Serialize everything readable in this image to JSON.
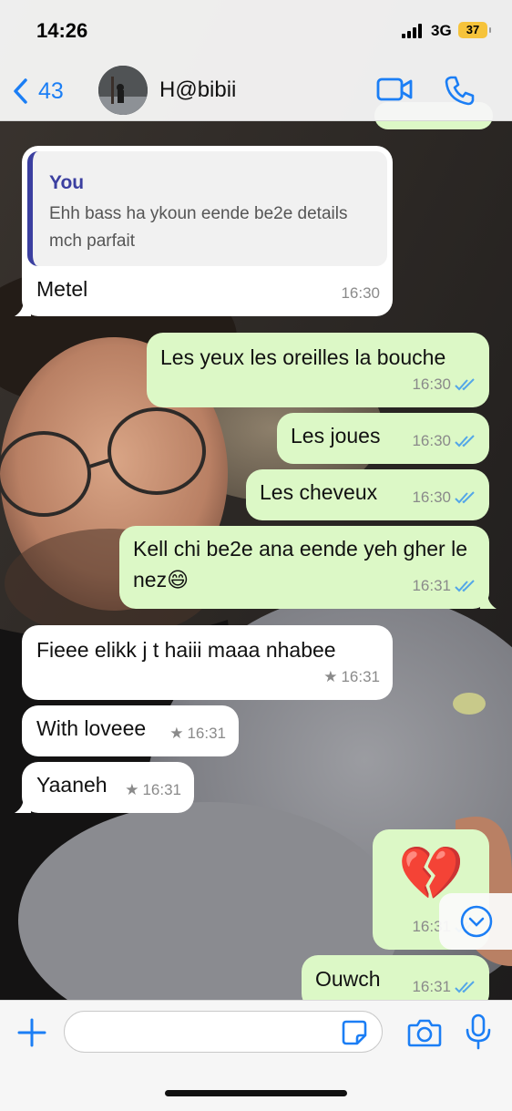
{
  "status": {
    "time": "14:26",
    "network": "3G",
    "battery": "37"
  },
  "header": {
    "back_count": "43",
    "contact_name": "H@bibii",
    "icons": [
      "video-call-icon",
      "phone-icon"
    ]
  },
  "messages": [
    {
      "dir": "in",
      "quote_author": "You",
      "quote_text": "Ehh bass ha ykoun eende be2e details mch parfait",
      "text": "Metel",
      "time": "16:30"
    },
    {
      "dir": "out",
      "text": "Les yeux les oreilles la bouche",
      "time": "16:30",
      "status": "read"
    },
    {
      "dir": "out",
      "text": "Les joues",
      "time": "16:30",
      "status": "read"
    },
    {
      "dir": "out",
      "text": "Les cheveux",
      "time": "16:30",
      "status": "read"
    },
    {
      "dir": "out",
      "text": "Kell chi be2e ana eende yeh gher le nez😄",
      "time": "16:31",
      "status": "read"
    },
    {
      "dir": "in",
      "text": "Fieee elikk j t haiii maaa nhabee",
      "time": "16:31",
      "starred": true
    },
    {
      "dir": "in",
      "text": "With loveee",
      "time": "16:31",
      "starred": true
    },
    {
      "dir": "in",
      "text": "Yaaneh",
      "time": "16:31",
      "starred": true
    },
    {
      "dir": "out",
      "text": "💔",
      "time": "16:31",
      "status": "read"
    },
    {
      "dir": "out",
      "text": "Ouwch",
      "time": "16:31",
      "status": "read"
    }
  ],
  "input": {
    "placeholder": ""
  },
  "colors": {
    "accent": "#1b7ef5",
    "outgoing": "#dcf8c6",
    "incoming": "#ffffff",
    "ticks": "#53a6e8",
    "quote_bar": "#3b3fa0"
  }
}
